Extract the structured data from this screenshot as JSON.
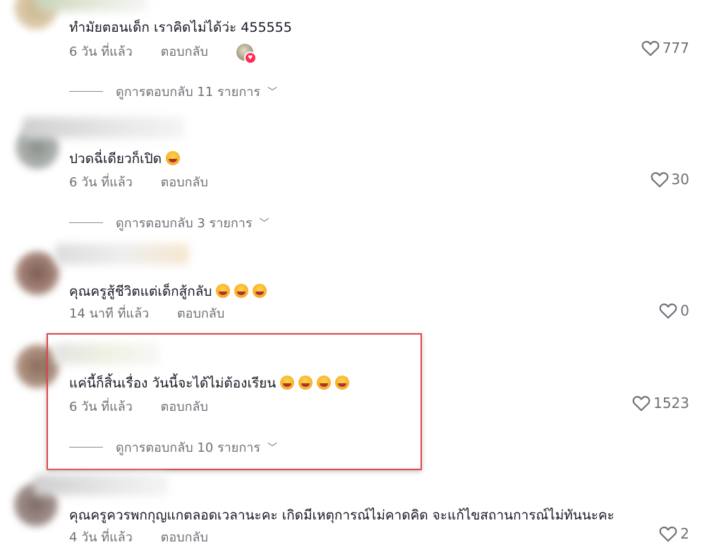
{
  "icons": {
    "like": "heart-outline-icon",
    "expand": "chevron-down-icon",
    "emoji": "laughing-emoji-icon"
  },
  "colors": {
    "text": "#161823",
    "secondary": "#6f7077",
    "highlight": "#e2434b",
    "creator_heart": "#fe2c55"
  },
  "comments": [
    {
      "text": "ทำมัยตอนเด็ก เราคิดไม่ได้ว่ะ 455555",
      "time": "6 วัน ที่แล้ว",
      "reply_label": "ตอบกลับ",
      "likes": "777",
      "view_replies": "ดูการตอบกลับ 11 รายการ"
    },
    {
      "text": "ปวดฉี่เดียวก็เปิด",
      "time": "6 วัน ที่แล้ว",
      "reply_label": "ตอบกลับ",
      "likes": "30",
      "view_replies": "ดูการตอบกลับ 3 รายการ"
    },
    {
      "text": "คุณครูสู้ชีวิตแต่เด็กสู้กลับ",
      "time": "14 นาที ที่แล้ว",
      "reply_label": "ตอบกลับ",
      "likes": "0"
    },
    {
      "text": "แค่นี้ก็สิ้นเรื่อง วันนี้จะได้ไม่ต้องเรียน",
      "time": "6 วัน ที่แล้ว",
      "reply_label": "ตอบกลับ",
      "likes": "1523",
      "view_replies": "ดูการตอบกลับ 10 รายการ"
    },
    {
      "text": "คุณครูควรพกกุญแกตลอดเวลานะคะ เกิดมีเหตุการณ์ไม่คาดคิด จะแก้ไขสถานการณ์ไม่ทันนะคะ",
      "time": "4 วัน ที่แล้ว",
      "reply_label": "ตอบกลับ",
      "likes": "2"
    }
  ]
}
